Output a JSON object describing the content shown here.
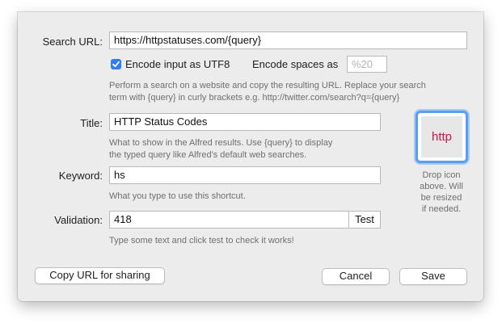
{
  "form": {
    "search_url": {
      "label": "Search URL:",
      "value": "https://httpstatuses.com/{query}"
    },
    "encode_utf8": {
      "label": "Encode input as UTF8",
      "checked": true
    },
    "encode_spaces": {
      "label": "Encode spaces as",
      "placeholder": "%20",
      "value": ""
    },
    "search_help": [
      "Perform a search on a website and copy the resulting URL. Replace your search",
      "term with {query} in curly brackets e.g. http://twitter.com/search?q={query}"
    ],
    "title": {
      "label": "Title:",
      "value": "HTTP Status Codes"
    },
    "title_help": [
      "What to show in the Alfred results. Use {query} to display",
      "the typed query like Alfred's default web searches."
    ],
    "keyword": {
      "label": "Keyword:",
      "value": "hs"
    },
    "keyword_help": "What you type to use this shortcut.",
    "validation": {
      "label": "Validation:",
      "value": "418",
      "test_label": "Test"
    },
    "validation_help": "Type some text and click test to check it works!"
  },
  "icon_well": {
    "text": "http",
    "text_color": "#c0184a",
    "hint": [
      "Drop icon",
      "above. Will",
      "be resized",
      "if needed."
    ]
  },
  "buttons": {
    "copy_url": "Copy URL for sharing",
    "cancel": "Cancel",
    "save": "Save"
  },
  "colors": {
    "accent": "#2f7cf6",
    "focus_ring": "#5a9ef0"
  }
}
